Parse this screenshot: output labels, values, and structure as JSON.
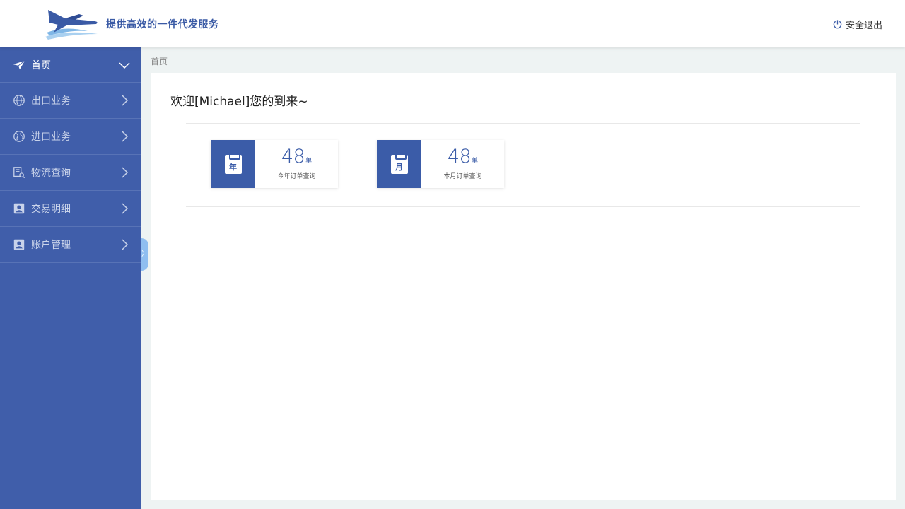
{
  "header": {
    "tagline": "提供高效的一件代发服务",
    "logout_label": "安全退出"
  },
  "colors": {
    "primary": "#405eaa",
    "accent": "#3b5ca8",
    "tagline": "#3a5aa5"
  },
  "sidebar": {
    "items": [
      {
        "label": "首页",
        "icon": "paper-plane-icon",
        "active": true
      },
      {
        "label": "出口业务",
        "icon": "globe-icon"
      },
      {
        "label": "进口业务",
        "icon": "globe-icon"
      },
      {
        "label": "物流查询",
        "icon": "document-search-icon"
      },
      {
        "label": "交易明细",
        "icon": "contact-card-icon"
      },
      {
        "label": "账户管理",
        "icon": "contact-card-icon"
      }
    ]
  },
  "collapse_toggle": "〉",
  "breadcrumb": "首页",
  "main": {
    "welcome": "欢迎[Michael]您的到来~",
    "stats": [
      {
        "icon_char": "年",
        "count": "48",
        "unit": "单",
        "caption": "今年订单查询"
      },
      {
        "icon_char": "月",
        "count": "48",
        "unit": "单",
        "caption": "本月订单查询"
      }
    ]
  }
}
